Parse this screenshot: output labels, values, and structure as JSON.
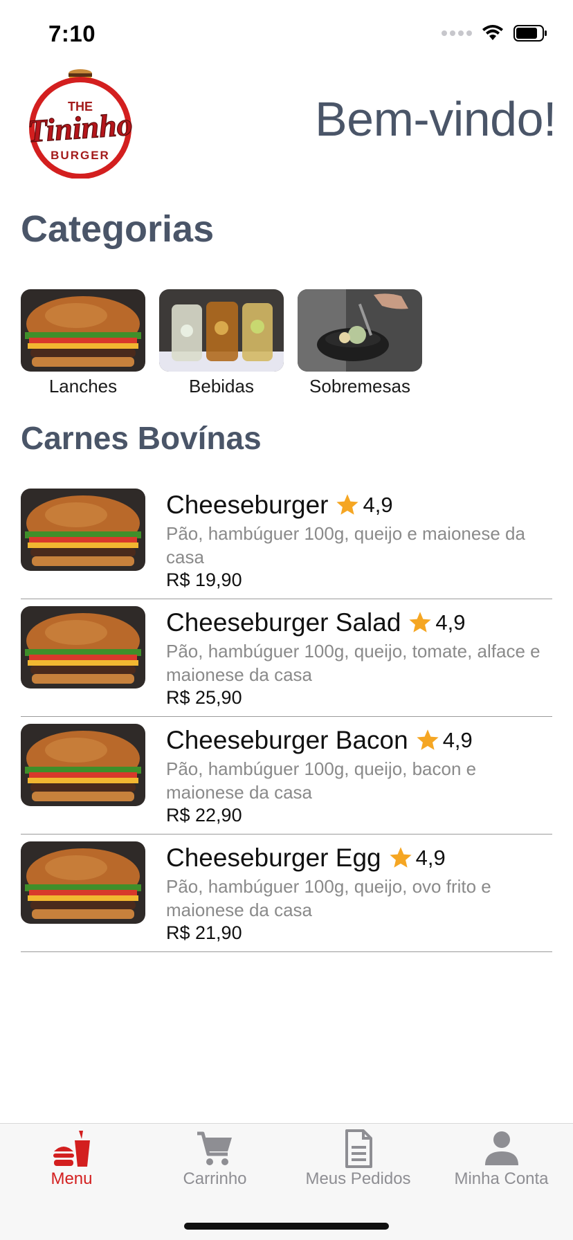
{
  "status_bar": {
    "time": "7:10"
  },
  "header": {
    "logo": {
      "line1": "THE",
      "line2": "Tininho",
      "line3": "BURGER"
    },
    "welcome": "Bem-vindo!"
  },
  "categories_title": "Categorias",
  "categories": [
    {
      "label": "Lanches"
    },
    {
      "label": "Bebidas"
    },
    {
      "label": "Sobremesas"
    }
  ],
  "section_title": "Carnes Bovínas",
  "products": [
    {
      "name": "Cheeseburger",
      "rating": "4,9",
      "description": "Pão, hambúguer 100g, queijo e maionese da casa",
      "price": "R$ 19,90"
    },
    {
      "name": "Cheeseburger Salad",
      "rating": "4,9",
      "description": "Pão, hambúguer 100g, queijo, tomate, alface e maionese da casa",
      "price": "R$ 25,90"
    },
    {
      "name": "Cheeseburger Bacon",
      "rating": "4,9",
      "description": "Pão, hambúguer 100g, queijo, bacon e maionese da casa",
      "price": "R$ 22,90"
    },
    {
      "name": "Cheeseburger Egg",
      "rating": "4,9",
      "description": "Pão, hambúguer 100g, queijo, ovo frito e maionese da casa",
      "price": "R$ 21,90"
    }
  ],
  "tab_bar": [
    {
      "label": "Menu",
      "icon": "fast-food-icon",
      "active": true
    },
    {
      "label": "Carrinho",
      "icon": "cart-icon",
      "active": false
    },
    {
      "label": "Meus Pedidos",
      "icon": "document-icon",
      "active": false
    },
    {
      "label": "Minha Conta",
      "icon": "person-icon",
      "active": false
    }
  ],
  "colors": {
    "accent": "#d31f1f",
    "heading": "#4a5568",
    "star": "#f5a623",
    "inactive": "#8e8e93"
  }
}
